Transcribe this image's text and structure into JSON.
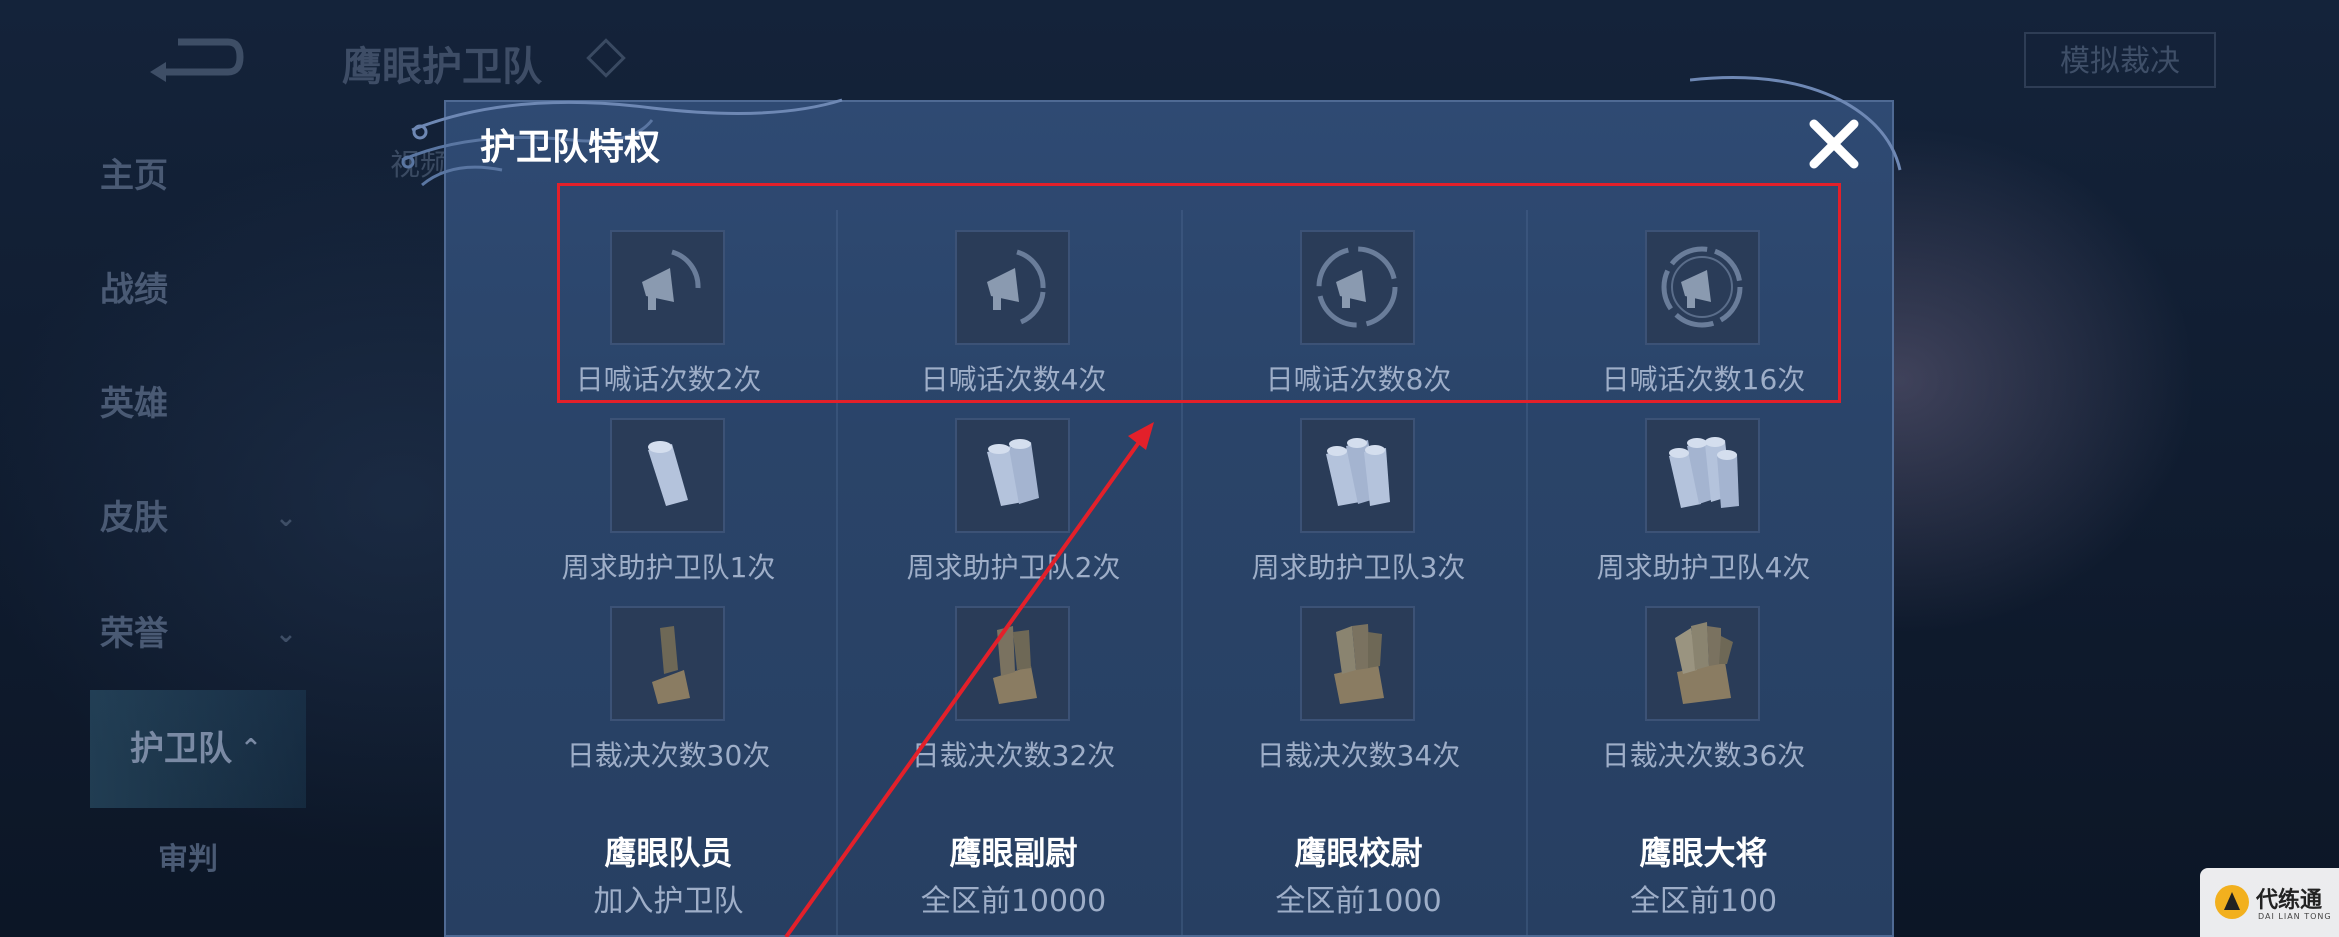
{
  "header": {
    "page_title": "鹰眼护卫队",
    "sub_tab": "视频",
    "simulate_button": "模拟裁决"
  },
  "sidebar": {
    "items": [
      {
        "label": "主页"
      },
      {
        "label": "战绩"
      },
      {
        "label": "英雄"
      },
      {
        "label": "皮肤",
        "chevron": "⌄"
      },
      {
        "label": "荣誉",
        "chevron": "⌄"
      },
      {
        "label": "护卫队",
        "chevron": "⌃"
      },
      {
        "label": "审判"
      }
    ]
  },
  "modal": {
    "title": "护卫队特权",
    "close_icon": "close-icon",
    "privileges": {
      "shout": [
        "日喊话次数2次",
        "日喊话次数4次",
        "日喊话次数8次",
        "日喊话次数16次"
      ],
      "help": [
        "周求助护卫队1次",
        "周求助护卫队2次",
        "周求助护卫队3次",
        "周求助护卫队4次"
      ],
      "verdict": [
        "日裁决次数30次",
        "日裁决次数32次",
        "日裁决次数34次",
        "日裁决次数36次"
      ]
    },
    "ranks": [
      {
        "name": "鹰眼队员",
        "requirement": "加入护卫队"
      },
      {
        "name": "鹰眼副尉",
        "requirement": "全区前10000"
      },
      {
        "name": "鹰眼校尉",
        "requirement": "全区前1000"
      },
      {
        "name": "鹰眼大将",
        "requirement": "全区前100"
      }
    ]
  },
  "watermark": {
    "name": "代练通",
    "sub": "DAI LIAN TONG"
  },
  "colors": {
    "highlight": "#e3202a",
    "modal_bg": "#2b4569",
    "label": "#9eaec8"
  }
}
